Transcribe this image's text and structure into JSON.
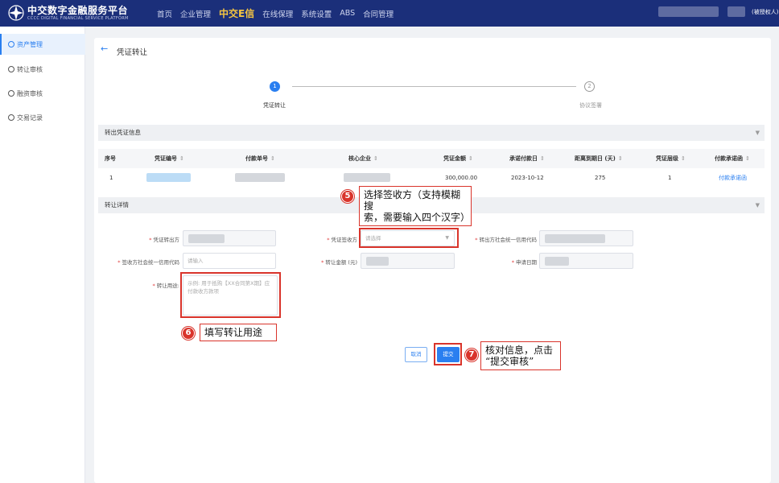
{
  "header": {
    "logo_title": "中交数字金融服务平台",
    "logo_subtitle": "CCCC DIGITAL FINANCIAL SERVICE PLATFORM",
    "nav": [
      {
        "label": "首页",
        "active": false
      },
      {
        "label": "企业管理",
        "active": false
      },
      {
        "label": "中交E信",
        "active": true
      },
      {
        "label": "在线保理",
        "active": false
      },
      {
        "label": "系统设置",
        "active": false
      },
      {
        "label": "ABS",
        "active": false
      },
      {
        "label": "合同管理",
        "active": false
      }
    ],
    "user_role": "(被授权人)"
  },
  "sidebar": {
    "items": [
      {
        "label": "资产管理",
        "icon": "asset-icon",
        "active": true
      },
      {
        "label": "转让审核",
        "icon": "review-icon",
        "active": false
      },
      {
        "label": "融资审核",
        "icon": "finance-icon",
        "active": false
      },
      {
        "label": "交易记录",
        "icon": "record-icon",
        "active": false
      }
    ]
  },
  "page": {
    "title": "凭证转让",
    "steps": [
      {
        "num": "1",
        "label": "凭证转让",
        "active": true
      },
      {
        "num": "2",
        "label": "协议签署",
        "active": false
      }
    ]
  },
  "transfer_info": {
    "section_title": "转出凭证信息",
    "columns": [
      "序号",
      "凭证编号",
      "付款单号",
      "核心企业",
      "凭证金额",
      "承诺付款日",
      "距离到期日 (天)",
      "凭证层级",
      "付款承诺函"
    ],
    "rows": [
      {
        "index": "1",
        "amount": "300,000.00",
        "due_date": "2023-10-12",
        "days": "275",
        "level": "1",
        "letter": "付款承诺函"
      }
    ]
  },
  "transfer_detail": {
    "section_title": "转让详情",
    "fields": {
      "transferor_label": "凭证转出方",
      "receiver_label": "凭证签收方",
      "receiver_placeholder": "请选择",
      "transferor_credit_label": "转出方社会统一信用代码",
      "receiver_credit_label": "签收方社会统一信用代码",
      "receiver_credit_placeholder": "请输入",
      "amount_label": "转让金额 (元)",
      "apply_date_label": "申请日期",
      "purpose_label": "转让用途:",
      "purpose_placeholder": "示例: 用于抵购【XX合同第X期】应付款收方款项"
    }
  },
  "buttons": {
    "cancel": "取消",
    "submit": "提交"
  },
  "annotations": [
    {
      "num": "5",
      "text_line1": "选择签收方（支持模糊搜",
      "text_line2": "索，需要输入四个汉字）"
    },
    {
      "num": "6",
      "text_line1": "填写转让用途"
    },
    {
      "num": "7",
      "text_line1": "核对信息，点击",
      "text_line2": "“提交审核”"
    }
  ],
  "colors": {
    "header_bg": "#1b2f7a",
    "accent": "#2a7ff0",
    "annotation": "#d9342b",
    "nav_active": "#f5c542"
  }
}
